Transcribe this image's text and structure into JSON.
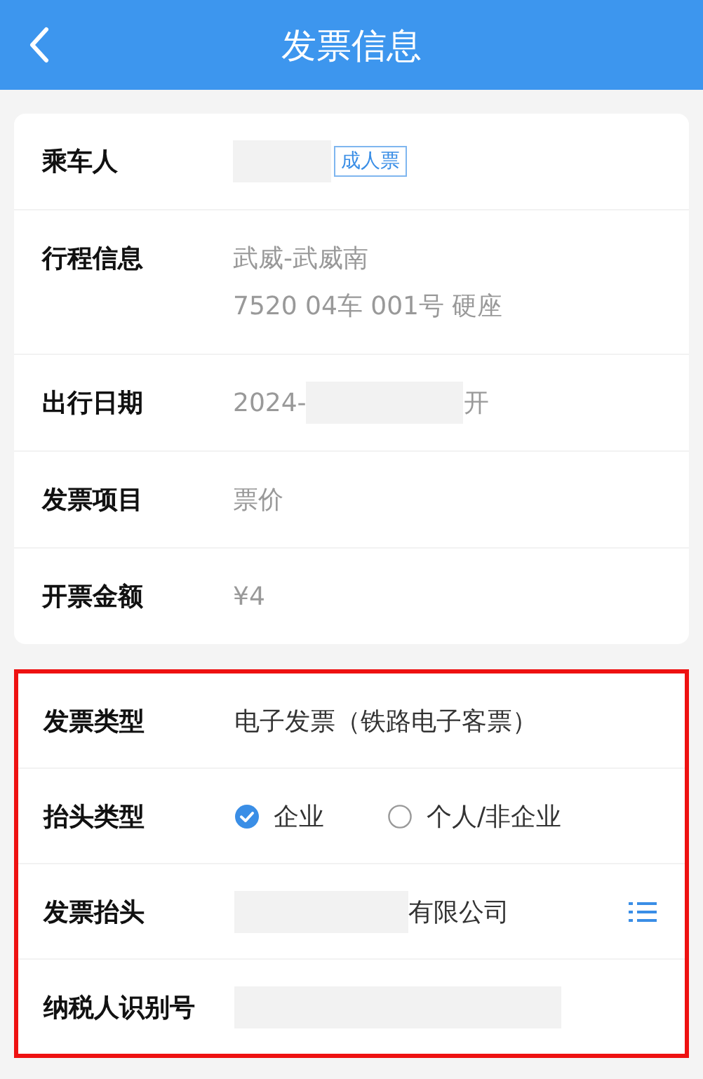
{
  "header": {
    "title": "发票信息"
  },
  "sections": [
    {
      "highlighted": false,
      "editable": false,
      "rows": [
        {
          "kind": "passenger",
          "label": "乘车人",
          "tag": "成人票"
        },
        {
          "kind": "lines",
          "label": "行程信息",
          "lines": [
            "武威-武威南",
            "7520 04车 001号 硬座"
          ]
        },
        {
          "kind": "date",
          "label": "出行日期",
          "prefix": "2024-",
          "suffix": "开"
        },
        {
          "kind": "text",
          "label": "发票项目",
          "value": "票价"
        },
        {
          "kind": "text",
          "label": "开票金额",
          "value": "¥4"
        }
      ]
    },
    {
      "highlighted": true,
      "editable": true,
      "rows": [
        {
          "kind": "text",
          "label": "发票类型",
          "value": "电子发票（铁路电子客票）"
        },
        {
          "kind": "radio",
          "label": "抬头类型",
          "options": [
            {
              "label": "企业",
              "selected": true
            },
            {
              "label": "个人/非企业",
              "selected": false
            }
          ]
        },
        {
          "kind": "company",
          "label": "发票抬头",
          "suffix": "有限公司"
        },
        {
          "kind": "redacted",
          "label": "纳税人识别号"
        }
      ]
    }
  ]
}
